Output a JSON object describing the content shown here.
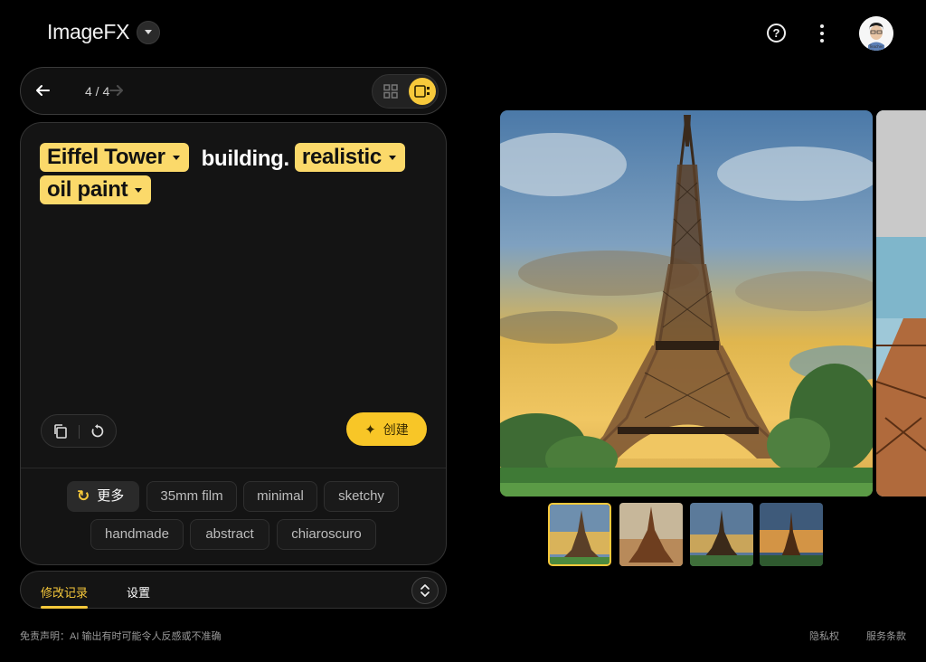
{
  "app": {
    "title": "ImageFX",
    "avatar_label": "Teacher"
  },
  "header": {
    "help_icon": "help-circle-icon",
    "menu_icon": "more-vert-icon"
  },
  "navigation": {
    "counter": "4 / 4",
    "view_modes": [
      "grid",
      "single"
    ],
    "active_view": "single"
  },
  "prompt": {
    "chip_1": "Eiffel Tower",
    "text_1": "building.",
    "chip_2": "realistic",
    "chip_3": "oil paint"
  },
  "actions": {
    "create_label": "创建"
  },
  "suggestions": {
    "more_label": "更多",
    "items": [
      "35mm film",
      "minimal",
      "sketchy",
      "handmade",
      "abstract",
      "chiaroscuro"
    ]
  },
  "tabs": {
    "history": "修改记录",
    "settings": "设置",
    "active": "history"
  },
  "footer": {
    "disclaimer": "免责声明：AI 输出有时可能令人反感或不准确",
    "privacy": "隐私权",
    "terms": "服务条款"
  },
  "gallery": {
    "image_count": 4,
    "selected_index": 0
  },
  "colors": {
    "accent": "#f7c93b",
    "chip": "#fbd96a",
    "background": "#000000",
    "panel": "#141414"
  }
}
